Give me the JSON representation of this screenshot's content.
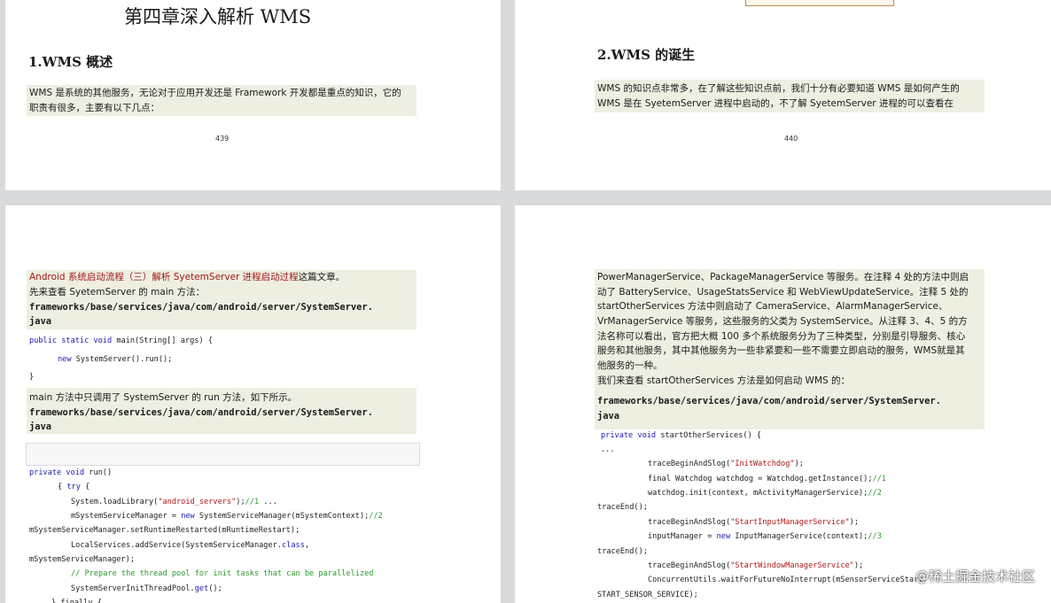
{
  "pages": {
    "p1": {
      "chapter_title": "第四章深入解析  WMS",
      "section_title": "1.WMS  概述",
      "para_lines": [
        "WMS 是系统的其他服务，无论对于应用开发还是 Framework 开发都是重点的知识，它的",
        "职责有很多，主要有以下几点："
      ],
      "page_number": "439"
    },
    "p2": {
      "section_title": "2.WMS  的诞生",
      "para_lines": [
        "WMS 的知识点非常多，在了解这些知识点前，我们十分有必要知道  WMS 是如何产生的",
        "WMS 是在  SyetemServer 进程中启动的，不了解  SyetemServer 进程的可以查看在"
      ],
      "page_number": "440"
    },
    "p3": {
      "link_text": "Android 系统启动流程（三）解析  SyetemServer 进程启动过程",
      "link_suffix": "这篇文章。",
      "intro": "先来查看  SyetemServer 的  main 方法：",
      "path1_a": "frameworks/base/services/java/com/android/server/SystemServer.",
      "path1_b": "java",
      "code1": {
        "l1_kw": "public static void",
        "l1_rest": " main(String[] args) {",
        "l2_kw": "new",
        "l2_rest": " SystemServer().run();",
        "l3": "}"
      },
      "mid_text": "main 方法中只调用了  SystemServer 的  run 方法，如下所示。",
      "path2_a": "frameworks/base/services/java/com/android/server/SystemServer.",
      "path2_b": "java",
      "code2": {
        "l1_kw": "private void",
        "l1_rest": " run()",
        "l2_a": "{ ",
        "l2_kw": "try",
        "l2_b": " {",
        "l3_a": "System.loadLibrary(",
        "l3_str": "\"android_servers\"",
        "l3_b": ");",
        "l3_cm": "//1",
        "l3_c": "          ...",
        "l4_a": "mSystemServiceManager = ",
        "l4_kw": "new",
        "l4_b": " SystemServiceManager(mSystemContext);",
        "l4_cm": "//2",
        "l5": "mSystemServiceManager.setRuntimeRestarted(mRuntimeRestart);",
        "l6_a": "LocalServices.addService(SystemServiceManager.",
        "l6_kw": "class",
        "l6_b": ",",
        "l7": "mSystemServiceManager);",
        "l8_cm": "// Prepare the thread pool for init tasks that can be parallelized",
        "l9_a": "SystemServerInitThreadPool.",
        "l9_kw": "get",
        "l9_b": "();",
        "l10": "} finally {"
      }
    },
    "p4": {
      "para_lines": [
        "PowerManagerService、PackageManagerService 等服务。在注释 4 处的方法中则启",
        "动了 BatteryService、UsageStatsService 和 WebViewUpdateService。注释 5 处的",
        "startOtherServices 方法中则启动了  CameraService、AlarmManagerService、",
        "VrManagerService 等服务，这些服务的父类为  SystemService。从注释 3、4、5 的方",
        "法名称可以看出，官方把大概  100 多个系统服务分为了三种类型，分别是引导服务、核心",
        "服务和其他服务，其中其他服务为一些非紧要和一些不需要立即启动的服务，WMS就是其",
        "他服务的一种。",
        "我们来查看  startOtherServices 方法是如何启动  WMS 的："
      ],
      "path_a": "frameworks/base/services/java/com/android/server/SystemServer.",
      "path_b": "java",
      "code": {
        "l1_kw": "private void",
        "l1_rest": " startOtherServices() {",
        "l2": "...",
        "l3_a": "traceBeginAndSlog(",
        "l3_str": "\"InitWatchdog\"",
        "l3_b": ");",
        "l4_a": "final Watchdog watchdog = Watchdog.getInstance();",
        "l4_cm": "//1",
        "l5_a": "watchdog.init(context, mActivityManagerService);",
        "l5_cm": "//2",
        "l6": "traceEnd();",
        "l7_a": "traceBeginAndSlog(",
        "l7_str": "\"StartInputManagerService\"",
        "l7_b": ");",
        "l8_a": "inputManager = ",
        "l8_kw": "new",
        "l8_b": " InputManagerService(context);",
        "l8_cm": "//3",
        "l9": "traceEnd();",
        "l10_a": "traceBeginAndSlog(",
        "l10_str": "\"StartWindowManagerService\"",
        "l10_b": ");",
        "l11": "ConcurrentUtils.waitForFutureNoInterrupt(mSensorServiceStart,",
        "l12": "START_SENSOR_SERVICE);"
      }
    }
  },
  "watermark": "@稀土掘金技术社区"
}
